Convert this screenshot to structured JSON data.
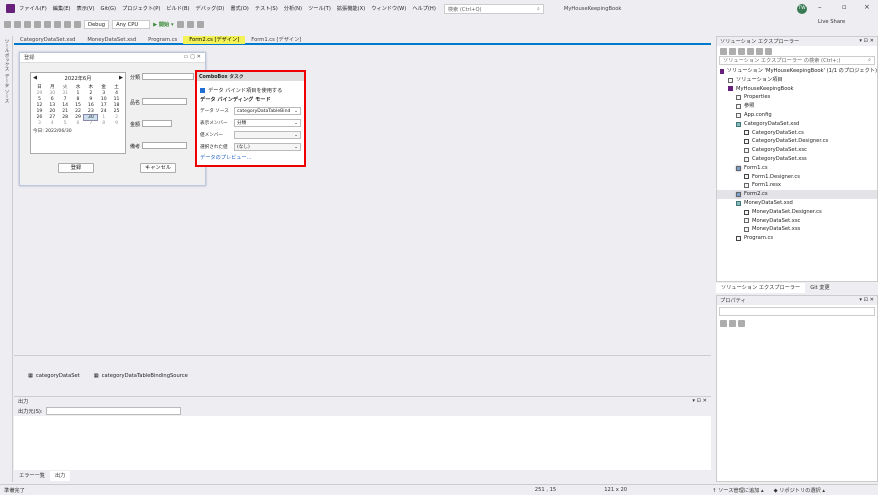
{
  "menu": {
    "items": [
      "ファイル(F)",
      "編集(E)",
      "表示(V)",
      "Git(G)",
      "プロジェクト(P)",
      "ビルド(B)",
      "デバッグ(D)",
      "書式(O)",
      "テスト(S)",
      "分析(N)",
      "ツール(T)",
      "拡張機能(X)",
      "ウィンドウ(W)",
      "ヘルプ(H)"
    ],
    "search_placeholder": "検索 (Ctrl+Q)",
    "project_name": "MyHouseKeepingBook",
    "avatar": "TW"
  },
  "toolbar": {
    "config": "Debug",
    "platform": "Any CPU",
    "run_label": "▶ 開始 ▾",
    "live_share": "Live Share"
  },
  "left_tabs": [
    "ツールボックス",
    "データ ソース"
  ],
  "doc_tabs": [
    "CategoryDataSet.xsd",
    "MoneyDataSet.xsd",
    "Program.cs",
    "Form2.cs [デザイン]",
    "Form1.cs [デザイン]"
  ],
  "form": {
    "title": "登録",
    "calendar": {
      "month": "2022年6月",
      "weekdays": [
        "日",
        "月",
        "火",
        "水",
        "木",
        "金",
        "土"
      ],
      "days": [
        "29",
        "30",
        "31",
        "1",
        "2",
        "3",
        "4",
        "5",
        "6",
        "7",
        "8",
        "9",
        "10",
        "11",
        "12",
        "13",
        "14",
        "15",
        "16",
        "17",
        "18",
        "19",
        "20",
        "21",
        "22",
        "23",
        "24",
        "25",
        "26",
        "27",
        "28",
        "29",
        "30",
        "1",
        "2",
        "3",
        "4",
        "5",
        "6",
        "7",
        "8",
        "9"
      ],
      "today": "今日: 2022/06/30"
    },
    "labels": {
      "category": "分類",
      "item": "品名",
      "amount": "金額",
      "memo": "備考"
    },
    "buttons": {
      "register": "登録",
      "cancel": "キャンセル"
    }
  },
  "combobox_tasks": {
    "title": "ComboBox タスク",
    "use_bound": "データ バインド項目を使用する",
    "mode": "データ バインディング モード",
    "rows": [
      {
        "label": "データ ソース",
        "value": "categoryDataTableBind"
      },
      {
        "label": "表示メンバー",
        "value": "分類"
      },
      {
        "label": "値メンバー",
        "value": ""
      },
      {
        "label": "選択された値",
        "value": "(なし)"
      }
    ],
    "preview": "データのプレビュー..."
  },
  "tray": [
    "categoryDataSet",
    "categoryDataTableBindingSource"
  ],
  "output": {
    "title": "出力",
    "source_label": "出力元(S):"
  },
  "bottom_tabs": [
    "エラー一覧",
    "出力"
  ],
  "solution": {
    "title": "ソリューション エクスプローラー",
    "search": "ソリューション エクスプローラー の検索 (Ctrl+;)",
    "tree": [
      "ソリューション 'MyHouseKeepingBook' (1/1 のプロジェクト)",
      "ソリューション項目",
      "MyHouseKeepingBook",
      "Properties",
      "参照",
      "App.config",
      "CategoryDataSet.xsd",
      "CategoryDataSet.cs",
      "CategoryDataSet.Designer.cs",
      "CategoryDataSet.xsc",
      "CategoryDataSet.xss",
      "Form1.cs",
      "Form1.Designer.cs",
      "Form1.resx",
      "Form2.cs",
      "MoneyDataSet.xsd",
      "MoneyDataSet.Designer.cs",
      "MoneyDataSet.xsc",
      "MoneyDataSet.xss",
      "Program.cs"
    ],
    "tabs": [
      "ソリューション エクスプローラー",
      "Git 変更"
    ]
  },
  "properties": {
    "title": "プロパティ"
  },
  "status": {
    "ready": "準備完了",
    "position": "251 , 15",
    "size": "121 x 20",
    "source_control": "↑ ソース管理に追加 ▴",
    "repo": "◆ リポジトリの選択 ▴"
  }
}
